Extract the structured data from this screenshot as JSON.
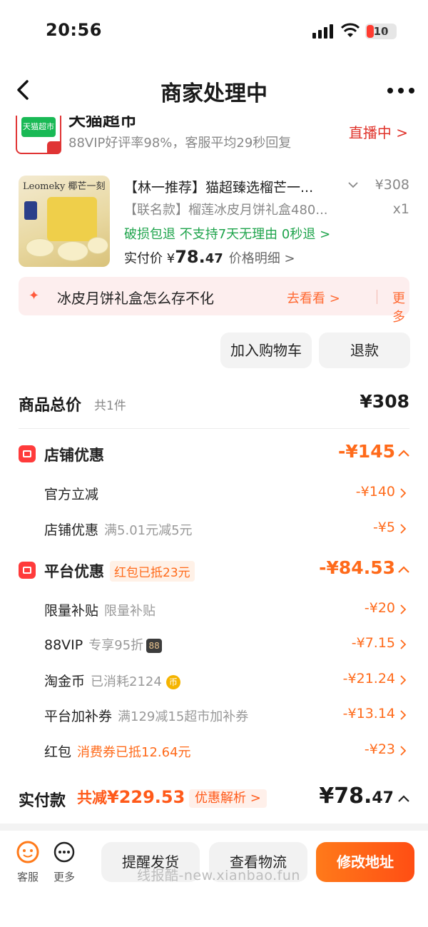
{
  "status_bar": {
    "time": "20:56",
    "battery": "10"
  },
  "nav": {
    "title": "商家处理中"
  },
  "shop": {
    "name": "天猫超市",
    "logo_text": "天猫超市",
    "subtitle": "88VIP好评率98%，客服平均29秒回复",
    "live_label": "直播中 >"
  },
  "product": {
    "image_brand": "Leomeky 椰芒一刻",
    "title": "【林一推荐】猫超臻选榴芒一...",
    "price": "¥308",
    "spec": "【联名款】榴莲冰皮月饼礼盒480...",
    "quantity": "x1",
    "service": "破损包退  不支持7天无理由  0秒退 >",
    "paid_prefix": "实付价 ¥",
    "paid_int": "78.",
    "paid_dec": "47",
    "price_detail": "价格明细 >"
  },
  "tip": {
    "text": "冰皮月饼礼盒怎么存不化",
    "go": "去看看 >",
    "more": "更多"
  },
  "actions": {
    "add_to_cart": "加入购物车",
    "refund": "退款"
  },
  "total": {
    "label": "商品总价",
    "count": "共1件",
    "value": "¥308"
  },
  "store_discount": {
    "label": "店铺优惠",
    "value": "-¥145",
    "rows": [
      {
        "label": "官方立减",
        "note": "",
        "value": "-¥140"
      },
      {
        "label": "店铺优惠",
        "note": "满5.01元减5元",
        "value": "-¥5"
      }
    ]
  },
  "platform_discount": {
    "label": "平台优惠",
    "tag": "红包已抵23元",
    "value": "-¥84.53",
    "rows": [
      {
        "label": "限量补贴",
        "note": "限量补贴",
        "value": "-¥20"
      },
      {
        "label": "88VIP",
        "note": "专享95折",
        "badge": "88",
        "value": "-¥7.15"
      },
      {
        "label": "淘金币",
        "note": "已消耗2124",
        "badge": "币",
        "value": "-¥21.24"
      },
      {
        "label": "平台加补券",
        "note": "满129减15超市加补券",
        "value": "-¥13.14"
      },
      {
        "label": "红包",
        "note": "消费券已抵12.64元",
        "value": "-¥23"
      }
    ]
  },
  "paid": {
    "label": "实付款",
    "saved_prefix": "共减",
    "saved": "¥229.53",
    "analyze": "优惠解析 >",
    "total_int": "¥78.",
    "total_dec": "47"
  },
  "bottom": {
    "customer_service": "客服",
    "more": "更多",
    "remind": "提醒发货",
    "track": "查看物流",
    "address": "修改地址"
  },
  "watermark": "线报酷-new.xianbao.fun",
  "colors": {
    "accent": "#ff6a1a",
    "primary_button": "#ff4e14",
    "service_green": "#1fa44c",
    "shop_red": "#e03434"
  }
}
